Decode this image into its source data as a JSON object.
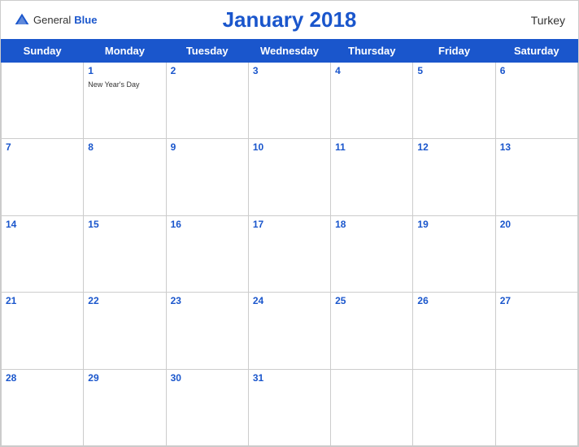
{
  "header": {
    "title": "January 2018",
    "country": "Turkey",
    "logo": {
      "general": "General",
      "blue": "Blue"
    }
  },
  "weekdays": [
    "Sunday",
    "Monday",
    "Tuesday",
    "Wednesday",
    "Thursday",
    "Friday",
    "Saturday"
  ],
  "weeks": [
    [
      {
        "day": "",
        "empty": true
      },
      {
        "day": "1",
        "holiday": "New Year's Day"
      },
      {
        "day": "2",
        "holiday": ""
      },
      {
        "day": "3",
        "holiday": ""
      },
      {
        "day": "4",
        "holiday": ""
      },
      {
        "day": "5",
        "holiday": ""
      },
      {
        "day": "6",
        "holiday": ""
      }
    ],
    [
      {
        "day": "7",
        "holiday": ""
      },
      {
        "day": "8",
        "holiday": ""
      },
      {
        "day": "9",
        "holiday": ""
      },
      {
        "day": "10",
        "holiday": ""
      },
      {
        "day": "11",
        "holiday": ""
      },
      {
        "day": "12",
        "holiday": ""
      },
      {
        "day": "13",
        "holiday": ""
      }
    ],
    [
      {
        "day": "14",
        "holiday": ""
      },
      {
        "day": "15",
        "holiday": ""
      },
      {
        "day": "16",
        "holiday": ""
      },
      {
        "day": "17",
        "holiday": ""
      },
      {
        "day": "18",
        "holiday": ""
      },
      {
        "day": "19",
        "holiday": ""
      },
      {
        "day": "20",
        "holiday": ""
      }
    ],
    [
      {
        "day": "21",
        "holiday": ""
      },
      {
        "day": "22",
        "holiday": ""
      },
      {
        "day": "23",
        "holiday": ""
      },
      {
        "day": "24",
        "holiday": ""
      },
      {
        "day": "25",
        "holiday": ""
      },
      {
        "day": "26",
        "holiday": ""
      },
      {
        "day": "27",
        "holiday": ""
      }
    ],
    [
      {
        "day": "28",
        "holiday": ""
      },
      {
        "day": "29",
        "holiday": ""
      },
      {
        "day": "30",
        "holiday": ""
      },
      {
        "day": "31",
        "holiday": ""
      },
      {
        "day": "",
        "empty": true
      },
      {
        "day": "",
        "empty": true
      },
      {
        "day": "",
        "empty": true
      }
    ]
  ]
}
